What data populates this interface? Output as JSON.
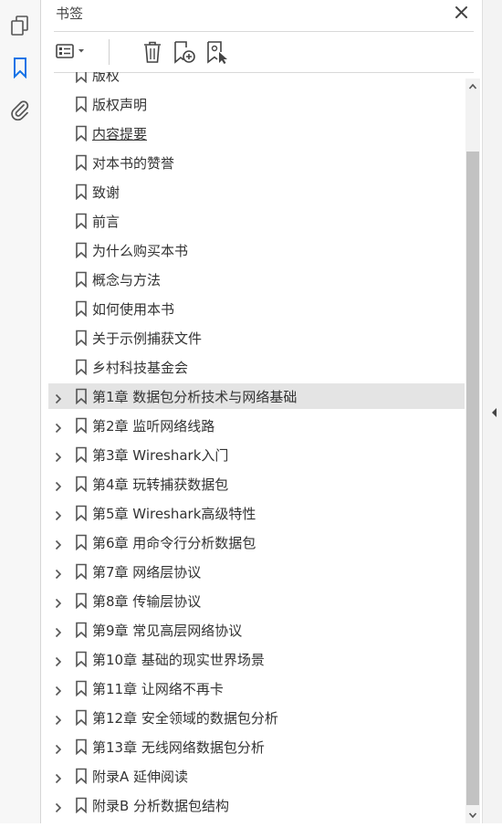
{
  "rail": {
    "items": [
      {
        "name": "pages",
        "icon": "page-thumbnails-icon",
        "active": false
      },
      {
        "name": "bookmarks",
        "icon": "bookmark-icon",
        "active": true
      },
      {
        "name": "attachments",
        "icon": "paperclip-icon",
        "active": false
      }
    ],
    "active_color": "#1473e6"
  },
  "panel": {
    "title": "书签",
    "close_icon": "close-icon"
  },
  "toolbar": {
    "items": [
      {
        "name": "options",
        "icon": "options-menu-icon"
      },
      {
        "name": "delete",
        "icon": "trash-icon"
      },
      {
        "name": "new-bookmark",
        "icon": "new-bookmark-icon"
      },
      {
        "name": "bookmark-from-selection",
        "icon": "bookmark-selection-icon"
      }
    ]
  },
  "bookmarks": [
    {
      "label": "版权",
      "expandable": false
    },
    {
      "label": "版权声明",
      "expandable": false
    },
    {
      "label": "内容提要",
      "expandable": false,
      "underlined": true
    },
    {
      "label": "对本书的赞誉",
      "expandable": false
    },
    {
      "label": "致谢",
      "expandable": false
    },
    {
      "label": "前言",
      "expandable": false
    },
    {
      "label": "为什么购买本书",
      "expandable": false
    },
    {
      "label": "概念与方法",
      "expandable": false
    },
    {
      "label": "如何使用本书",
      "expandable": false
    },
    {
      "label": "关于示例捕获文件",
      "expandable": false
    },
    {
      "label": "乡村科技基金会",
      "expandable": false
    },
    {
      "label": "第1章 数据包分析技术与网络基础",
      "expandable": true,
      "selected": true
    },
    {
      "label": "第2章 监听网络线路",
      "expandable": true
    },
    {
      "label": "第3章 Wireshark入门",
      "expandable": true
    },
    {
      "label": "第4章 玩转捕获数据包",
      "expandable": true
    },
    {
      "label": "第5章 Wireshark高级特性",
      "expandable": true
    },
    {
      "label": "第6章 用命令行分析数据包",
      "expandable": true
    },
    {
      "label": "第7章 网络层协议",
      "expandable": true
    },
    {
      "label": "第8章 传输层协议",
      "expandable": true
    },
    {
      "label": "第9章 常见高层网络协议",
      "expandable": true
    },
    {
      "label": "第10章 基础的现实世界场景",
      "expandable": true
    },
    {
      "label": "第11章 让网络不再卡",
      "expandable": true
    },
    {
      "label": "第12章 安全领域的数据包分析",
      "expandable": true
    },
    {
      "label": "第13章 无线网络数据包分析",
      "expandable": true
    },
    {
      "label": "附录A 延伸阅读",
      "expandable": true
    },
    {
      "label": "附录B 分析数据包结构",
      "expandable": true
    }
  ],
  "scrollbar": {
    "position": 0.1
  }
}
